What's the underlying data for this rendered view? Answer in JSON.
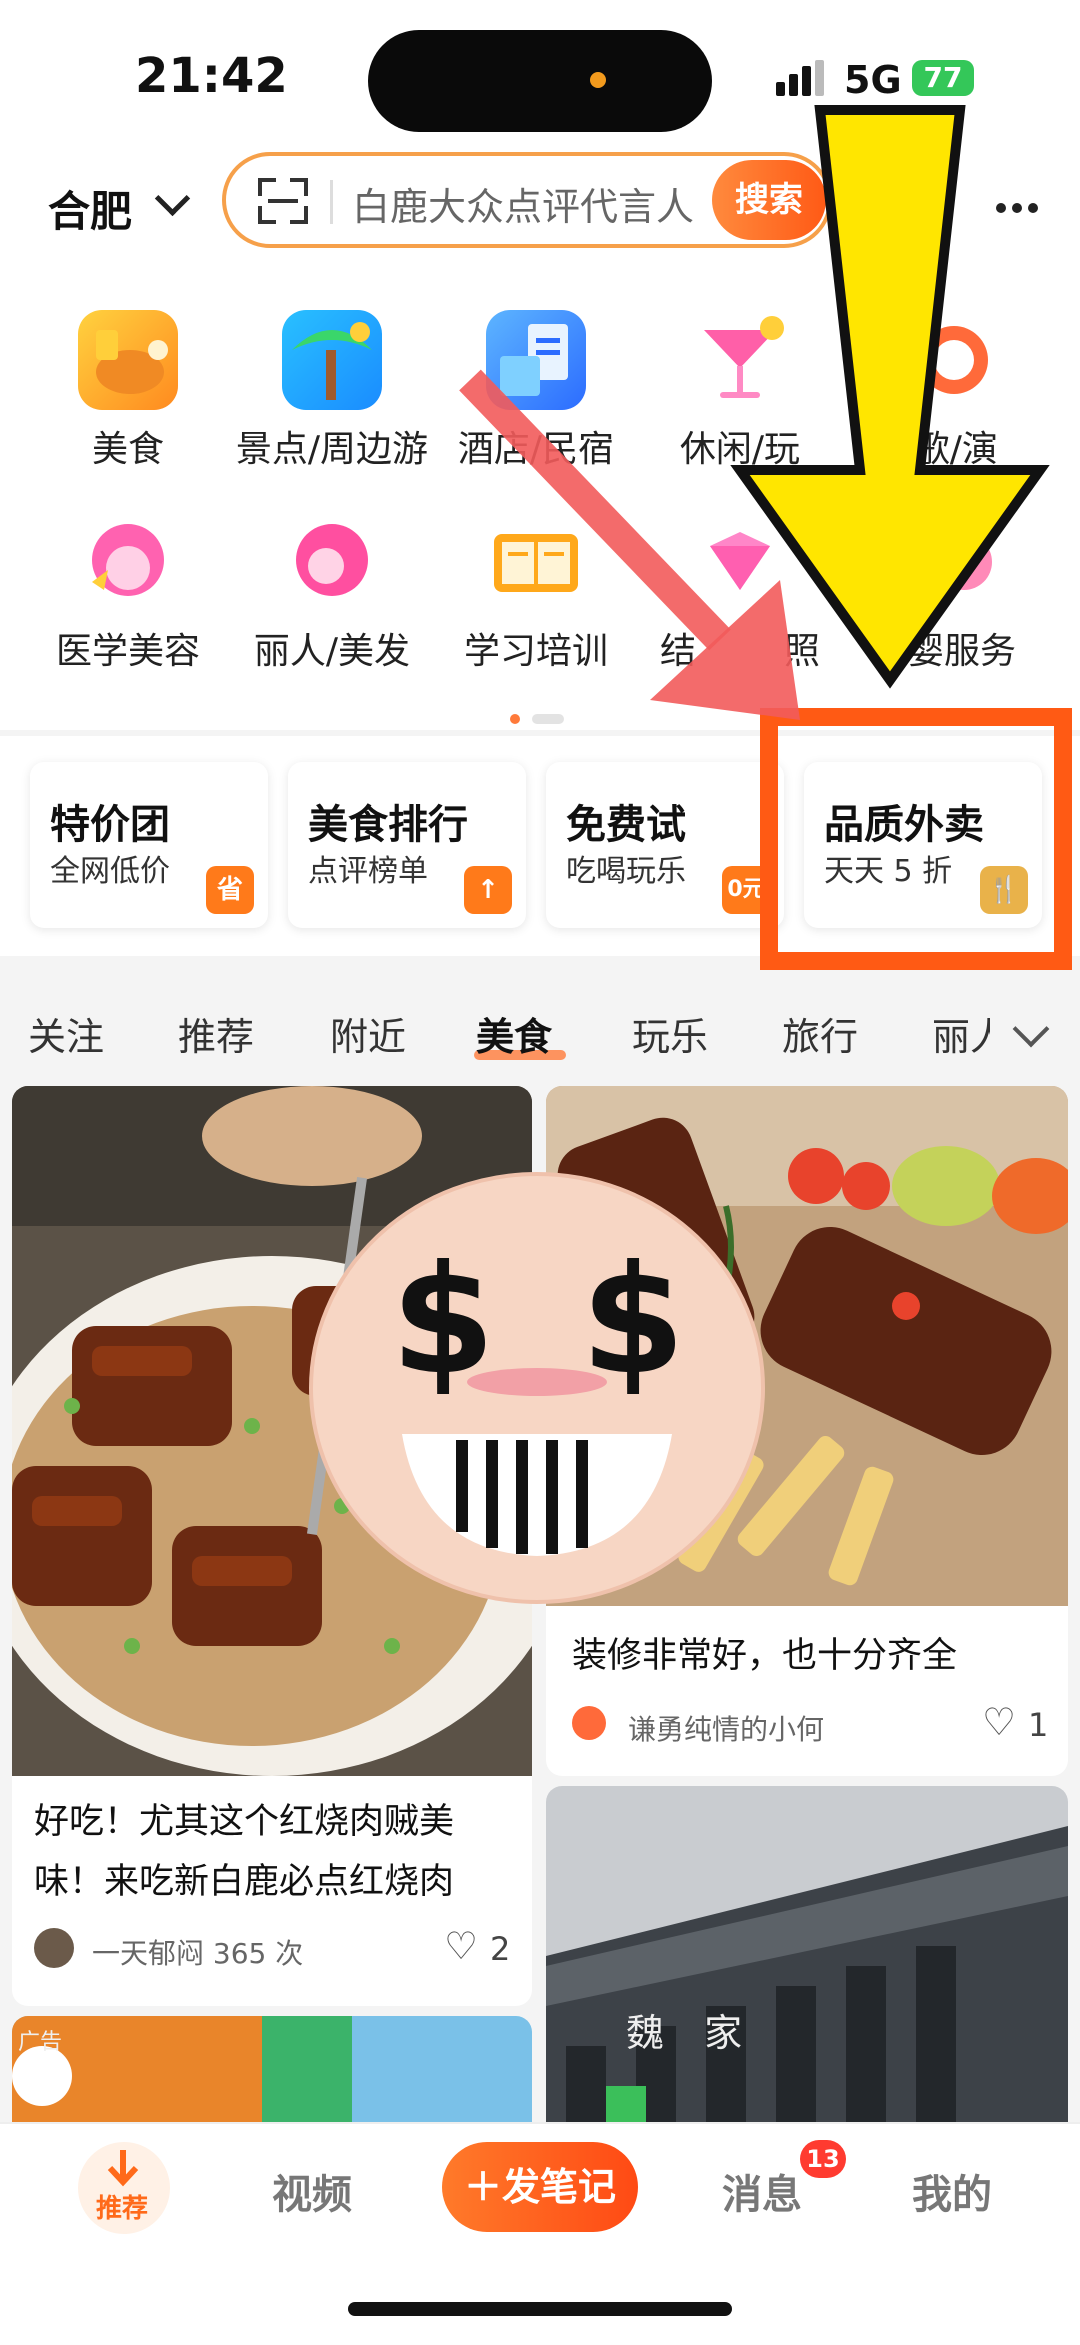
{
  "status_bar": {
    "time": "21:42",
    "network": "5G",
    "battery": "77"
  },
  "top_bar": {
    "city": "合肥",
    "search_placeholder": "白鹿大众点评代言人",
    "search_button": "搜索"
  },
  "categories_row1": [
    "美食",
    "景点/周边游",
    "酒店/民宿",
    "休闲/玩乐",
    "K歌/演出"
  ],
  "categories_row2": [
    "医学美容",
    "丽人/美发",
    "学习培训",
    "结婚/婚纱照",
    "母婴服务"
  ],
  "categories_visible_text": {
    "r1c4": "休闲/玩",
    "r1c5": "K歌/演",
    "r2c4": "结",
    "r2c4b": "照",
    "r2c5": "母婴服务",
    "r1c3": "酒店/民宿"
  },
  "promo_cards": [
    {
      "title": "特价团",
      "subtitle": "全网低价",
      "badge": "省"
    },
    {
      "title": "美食排行",
      "subtitle": "点评榜单",
      "badge": "↑"
    },
    {
      "title": "免费试",
      "subtitle": "吃喝玩乐",
      "badge": "0元"
    },
    {
      "title": "品质外卖",
      "subtitle": "天天 5 折",
      "badge": "🍴"
    }
  ],
  "feed_tabs": [
    "关注",
    "推荐",
    "附近",
    "美食",
    "玩乐",
    "旅行",
    "丽人"
  ],
  "feed_tabs_active": "美食",
  "feed_cards": [
    {
      "title_line1": "好吃！尤其这个红烧肉贼美",
      "title_line2": "味！来吃新白鹿必点红烧肉",
      "author": "一天郁闷 365 次",
      "likes": "2"
    },
    {
      "title_line1": "装修非常好，也十分齐全",
      "author": "谦勇纯情的小何",
      "likes": "1"
    },
    {
      "ad_tag": "广告"
    },
    {
      "sign_text": "魏 家"
    }
  ],
  "bottom_nav": {
    "home": "推荐",
    "video": "视频",
    "post": "＋发笔记",
    "messages": "消息",
    "messages_badge": "13",
    "me": "我的"
  },
  "colors": {
    "accent": "#ff5a16",
    "highlight_box": "#ff5a14",
    "arrow_yellow": "#ffe600",
    "arrow_red": "#f25b5b"
  }
}
